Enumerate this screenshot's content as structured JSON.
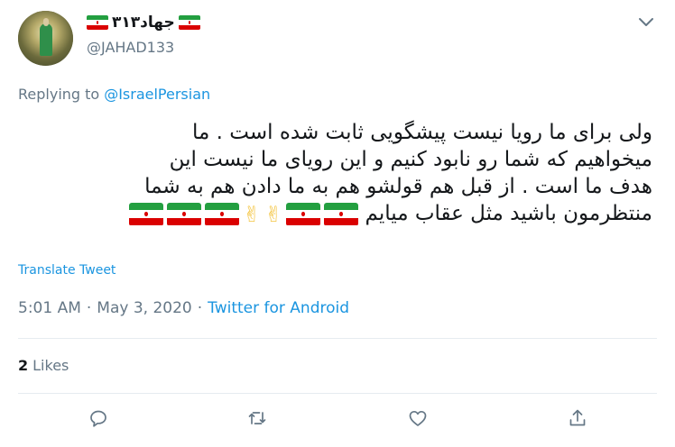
{
  "author": {
    "display_name": "جهاد۳۱۳",
    "handle": "@JAHAD133"
  },
  "reply": {
    "label": "Replying to",
    "to": "@IsraelPersian"
  },
  "tweet": {
    "lines": [
      "ولی برای ما رویا نیست پیشگویی ثابت شده است . ما",
      "میخواهیم که شما رو نابود کنیم و این رویای ما نیست این",
      "هدف ما است . از قبل هم قولشو هم به ما دادن هم به شما",
      "منتظرمون باشید مثل عقاب میایم"
    ]
  },
  "translate_label": "Translate Tweet",
  "meta": {
    "time": "5:01 AM",
    "separator": "·",
    "date": "May 3, 2020",
    "source": "Twitter for Android"
  },
  "stats": {
    "likes_count": "2",
    "likes_label": "Likes"
  },
  "colors": {
    "link": "#1b95e0",
    "secondary_text": "#657786",
    "primary_text": "#14171a",
    "divider": "#e6ecf0",
    "flag_green": "#239f40",
    "flag_red": "#da0000"
  },
  "icons": {
    "caret": "chevron-down-icon",
    "reply": "reply-bubble-icon",
    "retweet": "retweet-icon",
    "like": "heart-icon",
    "share": "share-arrow-icon",
    "emoji_flag": "iran-flag-icon",
    "emoji_victory": "victory-hand-icon"
  }
}
